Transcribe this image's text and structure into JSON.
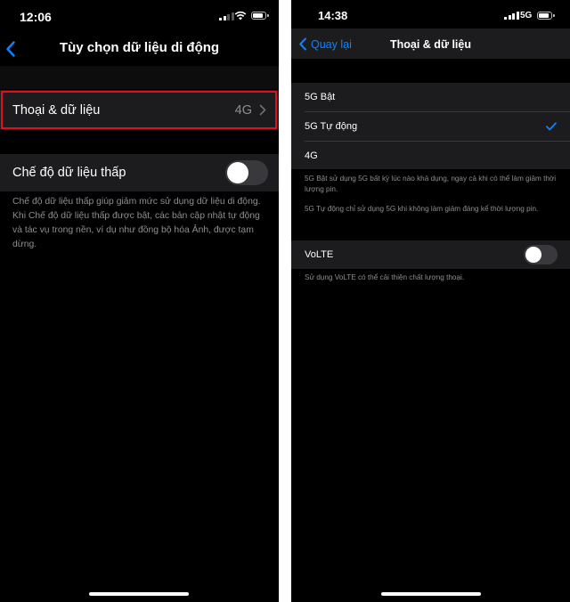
{
  "left": {
    "status": {
      "time": "12:06"
    },
    "nav": {
      "title": "Tùy chọn dữ liệu di động"
    },
    "voice_data_row": {
      "label": "Thoại & dữ liệu",
      "value": "4G"
    },
    "low_data_row": {
      "label": "Chế độ dữ liệu thấp",
      "enabled": false
    },
    "low_data_footnote": "Chế độ dữ liệu thấp giúp giảm mức sử dụng dữ liệu di động. Khi Chế độ dữ liệu thấp được bật, các bản cập nhật tự động và tác vụ trong nền, ví dụ như đồng bộ hóa Ảnh, được tạm dừng."
  },
  "right": {
    "status": {
      "time": "14:38",
      "network": "5G"
    },
    "nav": {
      "back_label": "Quay lại",
      "title": "Thoại & dữ liệu"
    },
    "options": [
      {
        "label": "5G Bật",
        "selected": false
      },
      {
        "label": "5G Tự động",
        "selected": true
      },
      {
        "label": "4G",
        "selected": false
      }
    ],
    "footnote_5g_on": "5G Bật sử dụng 5G bất kỳ lúc nào khả dụng, ngay cả khi có thể làm giảm thời lượng pin.",
    "footnote_5g_auto": "5G Tự động chỉ sử dụng 5G khi không làm giảm đáng kể thời lượng pin.",
    "volte_row": {
      "label": "VoLTE",
      "enabled": false
    },
    "volte_footnote": "Sử dụng VoLTE có thể cải thiện chất lượng thoại."
  },
  "colors": {
    "accent": "#0a84ff",
    "highlight": "#e0101e",
    "cell_bg": "#1c1c1e",
    "secondary_text": "#8e8e93"
  }
}
